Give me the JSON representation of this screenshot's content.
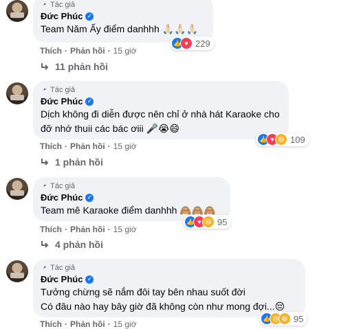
{
  "author_tag": "Tác giả",
  "author_name": "Đức Phúc",
  "actions": {
    "like": "Thích",
    "reply": "Phản hồi",
    "separator": "·"
  },
  "comments": [
    {
      "text_lines": [
        "Team Năm Ấy điểm danhhh 🙏🏻🙏🏻🙏🏻"
      ],
      "time": "15 giờ",
      "reaction_count": "229",
      "reactions": [
        "like-icon",
        "love-icon"
      ],
      "replies": "11 phản hồi"
    },
    {
      "text_lines": [
        "Dịch không đi diễn được nên chỉ ở nhà hát Karaoke cho",
        "đỡ nhớ thuii các bác ơiii 🎤😭😄"
      ],
      "time": "15 giờ",
      "reaction_count": "109",
      "reactions": [
        "like-icon",
        "love-icon",
        "haha-icon"
      ],
      "replies": "1 phản hồi"
    },
    {
      "text_lines": [
        "Team mê Karaoke điểm danhhh 🙈🙈🙈"
      ],
      "time": "15 giờ",
      "reaction_count": "95",
      "reactions": [
        "like-icon",
        "love-icon",
        "haha-icon"
      ],
      "replies": "4 phản hồi"
    },
    {
      "text_lines": [
        "Tưởng chừng sẽ nắm đôi tay bên nhau suốt đời",
        "Có đâu nào hay bây giờ đã không còn như mong đợi...😔"
      ],
      "time": "15 giờ",
      "reaction_count": "95",
      "reactions": [
        "like-icon",
        "sad-icon",
        "haha-icon"
      ],
      "replies": ""
    }
  ],
  "colors": {
    "bubble": "#f0f2f5",
    "secondary_text": "#65676b",
    "like_blue": "#1877f2",
    "love_red": "#f33e58",
    "haha_yellow": "#f7b125"
  }
}
